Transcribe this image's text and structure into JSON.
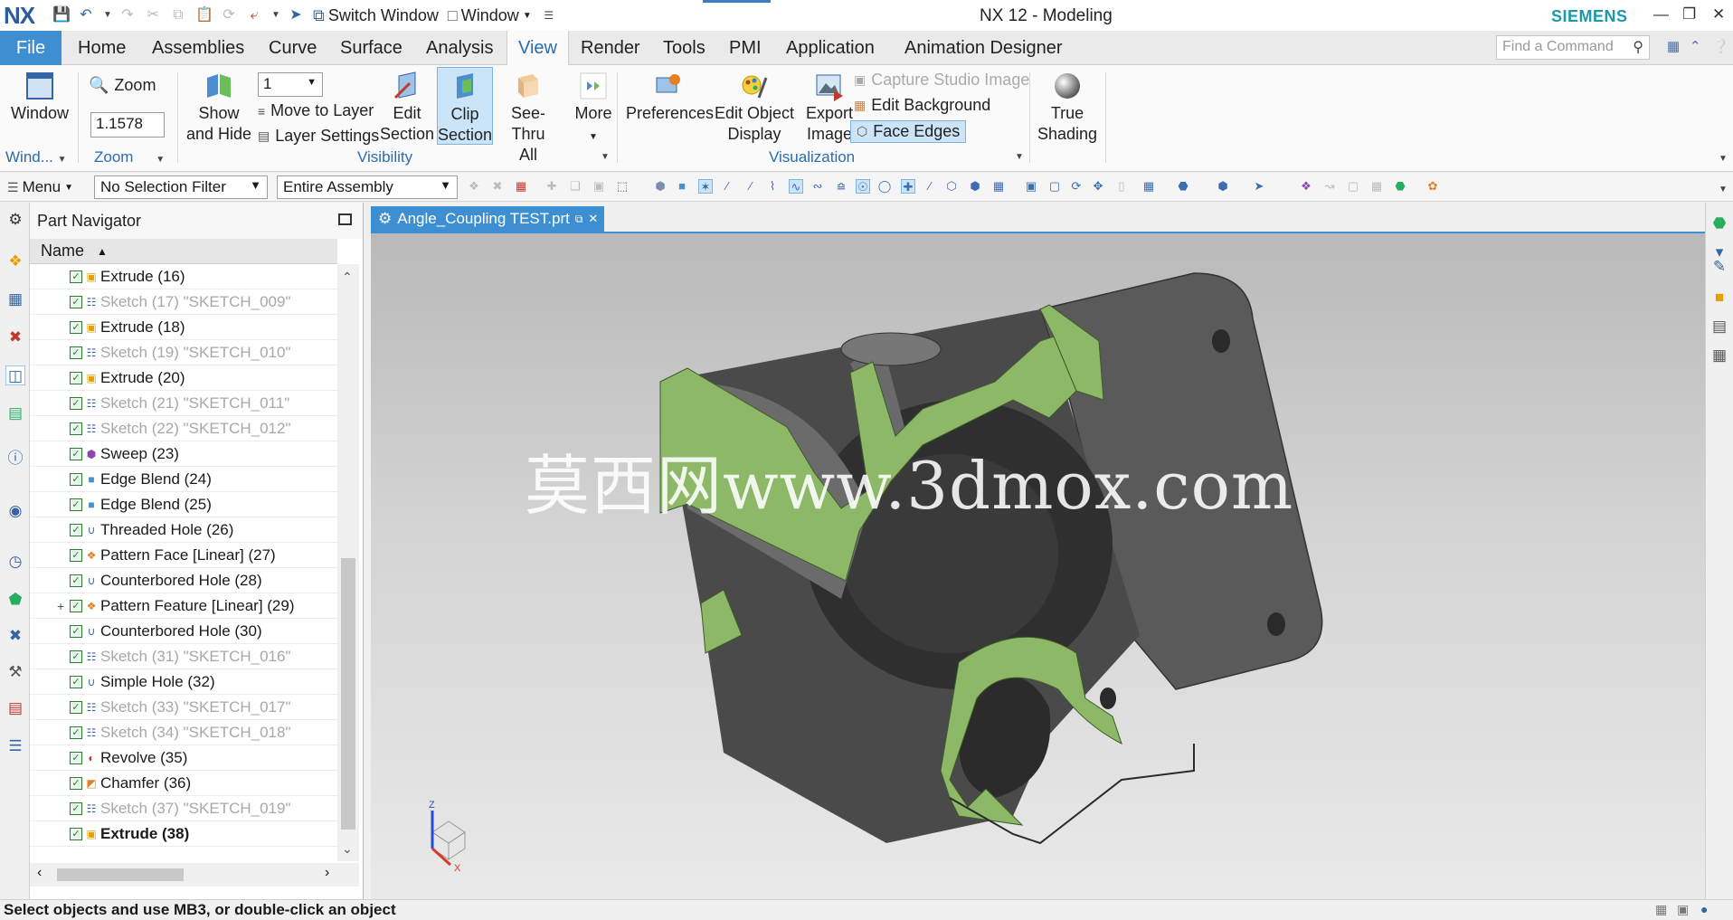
{
  "titlebar": {
    "logo": "NX",
    "switch_window": "Switch Window",
    "window_menu": "Window",
    "title": "NX 12 - Modeling",
    "brand": "SIEMENS"
  },
  "tabs": {
    "file": "File",
    "items": [
      "Home",
      "Assemblies",
      "Curve",
      "Surface",
      "Analysis",
      "View",
      "Render",
      "Tools",
      "PMI",
      "Application",
      "Animation Designer"
    ],
    "active": "View"
  },
  "search": {
    "placeholder": "Find a Command"
  },
  "ribbon": {
    "window": {
      "label": "Window",
      "group": "Wind..."
    },
    "zoom": {
      "button": "Zoom",
      "value": "1.1578",
      "group": "Zoom"
    },
    "visibility": {
      "show_hide_1": "Show",
      "show_hide_2": "and Hide",
      "layer_value": "1",
      "move_to_layer": "Move to Layer",
      "layer_settings": "Layer Settings",
      "edit_section_1": "Edit",
      "edit_section_2": "Section",
      "clip_section_1": "Clip",
      "clip_section_2": "Section",
      "see_thru_1": "See-Thru",
      "see_thru_2": "All",
      "more": "More",
      "group": "Visibility"
    },
    "visualization": {
      "preferences": "Preferences",
      "edit_object_1": "Edit Object",
      "edit_object_2": "Display",
      "export_1": "Export",
      "export_2": "Image",
      "capture": "Capture Studio Image",
      "edit_background": "Edit Background",
      "face_edges": "Face Edges",
      "group": "Visualization"
    },
    "shading": {
      "label_1": "True",
      "label_2": "Shading"
    }
  },
  "selection": {
    "menu": "Menu",
    "filter": "No Selection Filter",
    "scope": "Entire Assembly"
  },
  "navigator": {
    "title": "Part Navigator",
    "column": "Name",
    "rows": [
      {
        "label": "Extrude (16)",
        "kind": "extrude",
        "dim": false,
        "bold": false
      },
      {
        "label": "Sketch (17) \"SKETCH_009\"",
        "kind": "sketch",
        "dim": true,
        "bold": false
      },
      {
        "label": "Extrude (18)",
        "kind": "extrude",
        "dim": false,
        "bold": false
      },
      {
        "label": "Sketch (19) \"SKETCH_010\"",
        "kind": "sketch",
        "dim": true,
        "bold": false
      },
      {
        "label": "Extrude (20)",
        "kind": "extrude",
        "dim": false,
        "bold": false
      },
      {
        "label": "Sketch (21) \"SKETCH_011\"",
        "kind": "sketch",
        "dim": true,
        "bold": false
      },
      {
        "label": "Sketch (22) \"SKETCH_012\"",
        "kind": "sketch",
        "dim": true,
        "bold": false
      },
      {
        "label": "Sweep (23)",
        "kind": "sweep",
        "dim": false,
        "bold": false
      },
      {
        "label": "Edge Blend (24)",
        "kind": "blend",
        "dim": false,
        "bold": false
      },
      {
        "label": "Edge Blend (25)",
        "kind": "blend",
        "dim": false,
        "bold": false
      },
      {
        "label": "Threaded Hole (26)",
        "kind": "hole",
        "dim": false,
        "bold": false
      },
      {
        "label": "Pattern Face [Linear] (27)",
        "kind": "pattern",
        "dim": false,
        "bold": false
      },
      {
        "label": "Counterbored Hole (28)",
        "kind": "hole",
        "dim": false,
        "bold": false
      },
      {
        "label": "Pattern Feature [Linear] (29)",
        "kind": "pattern",
        "dim": false,
        "bold": false,
        "expandable": true
      },
      {
        "label": "Counterbored Hole (30)",
        "kind": "hole",
        "dim": false,
        "bold": false
      },
      {
        "label": "Sketch (31) \"SKETCH_016\"",
        "kind": "sketch",
        "dim": true,
        "bold": false
      },
      {
        "label": "Simple Hole (32)",
        "kind": "hole",
        "dim": false,
        "bold": false
      },
      {
        "label": "Sketch (33) \"SKETCH_017\"",
        "kind": "sketch",
        "dim": true,
        "bold": false
      },
      {
        "label": "Sketch (34) \"SKETCH_018\"",
        "kind": "sketch",
        "dim": true,
        "bold": false
      },
      {
        "label": "Revolve (35)",
        "kind": "revolve",
        "dim": false,
        "bold": false
      },
      {
        "label": "Chamfer (36)",
        "kind": "chamfer",
        "dim": false,
        "bold": false
      },
      {
        "label": "Sketch (37) \"SKETCH_019\"",
        "kind": "sketch",
        "dim": true,
        "bold": false
      },
      {
        "label": "Extrude (38)",
        "kind": "extrude",
        "dim": false,
        "bold": true
      }
    ]
  },
  "graphics": {
    "tab_label": "Angle_Coupling TEST.prt",
    "watermark": "莫西网www.3dmox.com",
    "triad": {
      "z": "Z",
      "x": "X"
    }
  },
  "status": {
    "message": "Select objects and use MB3, or double-click an object"
  },
  "colors": {
    "accent": "#3d8fd1",
    "section_face": "#8db868",
    "part": "#5e5e5e",
    "brand": "#1b9aaa"
  }
}
